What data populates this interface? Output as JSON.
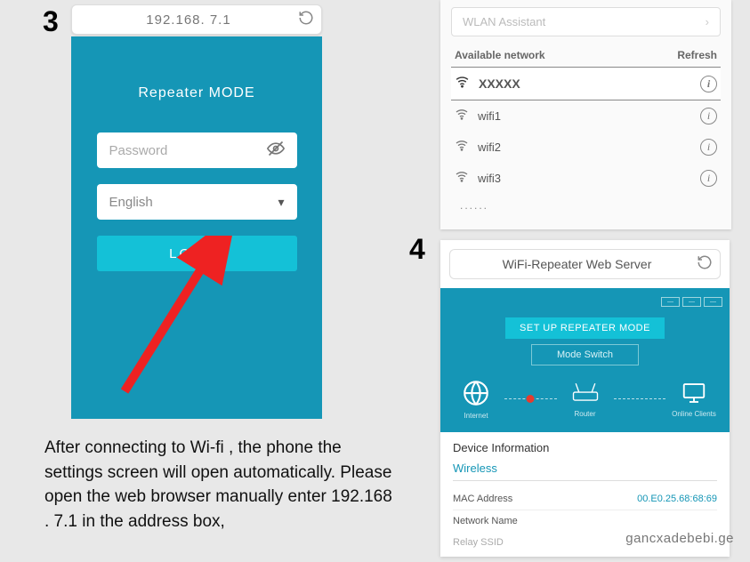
{
  "step3": {
    "number": "3",
    "address": "192.168. 7.1",
    "title": "Repeater MODE",
    "password_placeholder": "Password",
    "language": "English",
    "login": "LOGIN",
    "caption": "After connecting to Wi-fi , the phone the settings screen will open automatically. Please open the web browser manually enter 192.168 . 7.1 in the address box,"
  },
  "networks": {
    "assistant": "WLAN Assistant",
    "head_available": "Available network",
    "head_refresh": "Refresh",
    "items": [
      {
        "name": "XXXXX",
        "selected": true
      },
      {
        "name": "wifi1",
        "selected": false
      },
      {
        "name": "wifi2",
        "selected": false
      },
      {
        "name": "wifi3",
        "selected": false
      }
    ],
    "more": "......"
  },
  "step4": {
    "number": "4",
    "address": "WiFi-Repeater Web Server",
    "mini_pills": [
      "—",
      "—",
      "—"
    ],
    "setup_btn": "SET UP REPEATER MODE",
    "mode_switch": "Mode Switch",
    "nodes": {
      "internet": "Internet",
      "router": "Router",
      "clients": "Online Clients"
    },
    "device_info_title": "Device Information",
    "wireless": "Wireless",
    "mac_label": "MAC Address",
    "mac_value": "00.E0.25.68:68:69",
    "netname_label": "Network Name",
    "relay_label": "Relay SSID"
  },
  "watermark": "gancxadebebi.ge"
}
